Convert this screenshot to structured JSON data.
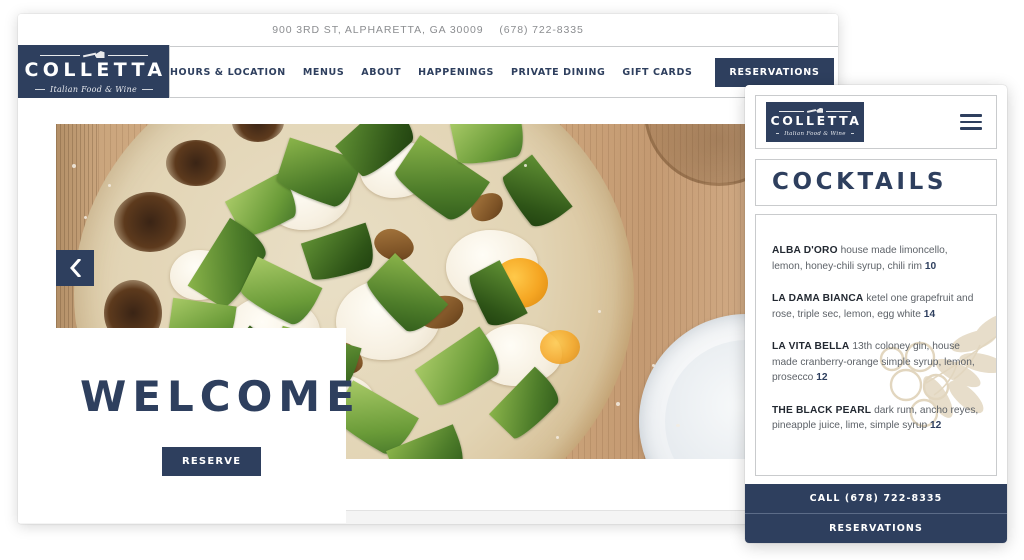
{
  "desktop": {
    "topbar": {
      "address": "900 3RD ST, ALPHARETTA, GA 30009",
      "phone": "(678) 722-8335"
    },
    "logo": {
      "word": "COLLETTA",
      "tagline": "Italian Food & Wine",
      "icon": "pizza-peel-icon"
    },
    "nav": {
      "items": [
        {
          "label": "HOURS & LOCATION"
        },
        {
          "label": "MENUS"
        },
        {
          "label": "ABOUT"
        },
        {
          "label": "HAPPENINGS"
        },
        {
          "label": "PRIVATE DINING"
        },
        {
          "label": "GIFT CARDS"
        }
      ],
      "cta": "RESERVATIONS"
    },
    "hero": {
      "heading": "WELCOME",
      "reserve_button": "RESERVE",
      "prev_arrow_icon": "chevron-left-icon",
      "play_icon": "play-icon",
      "image_alt": "wood-fired pizza with arugula, mushrooms, mozzarella and egg yolk on a wooden board"
    }
  },
  "mobile": {
    "logo": {
      "word": "COLLETTA",
      "tagline": "Italian Food & Wine"
    },
    "menu_icon": "hamburger-menu-icon",
    "section_title": "COCKTAILS",
    "decoration": "olive-branch-watermark",
    "cocktails": [
      {
        "name": "ALBA D'ORO",
        "description": "house made limoncello, lemon, honey-chili syrup, chili rim",
        "price": "10"
      },
      {
        "name": "LA DAMA BIANCA",
        "description": "ketel one grapefruit and rose, triple sec, lemon, egg white",
        "price": "14"
      },
      {
        "name": "LA VITA BELLA",
        "description": "13th coloney gin, house made cranberry-orange simple syrup, lemon, prosecco",
        "price": "12"
      },
      {
        "name": "THE BLACK PEARL",
        "description": "dark rum, ancho reyes, pineapple juice, lime, simple syrup",
        "price": "12"
      }
    ],
    "call_button": "CALL (678) 722-8335",
    "reservations_button": "RESERVATIONS"
  },
  "colors": {
    "navy": "#2e3f5e",
    "border": "#c9cbcd",
    "body_text": "#5d6268",
    "heading_text": "#222831",
    "olive_gold": "#cbb68c"
  }
}
